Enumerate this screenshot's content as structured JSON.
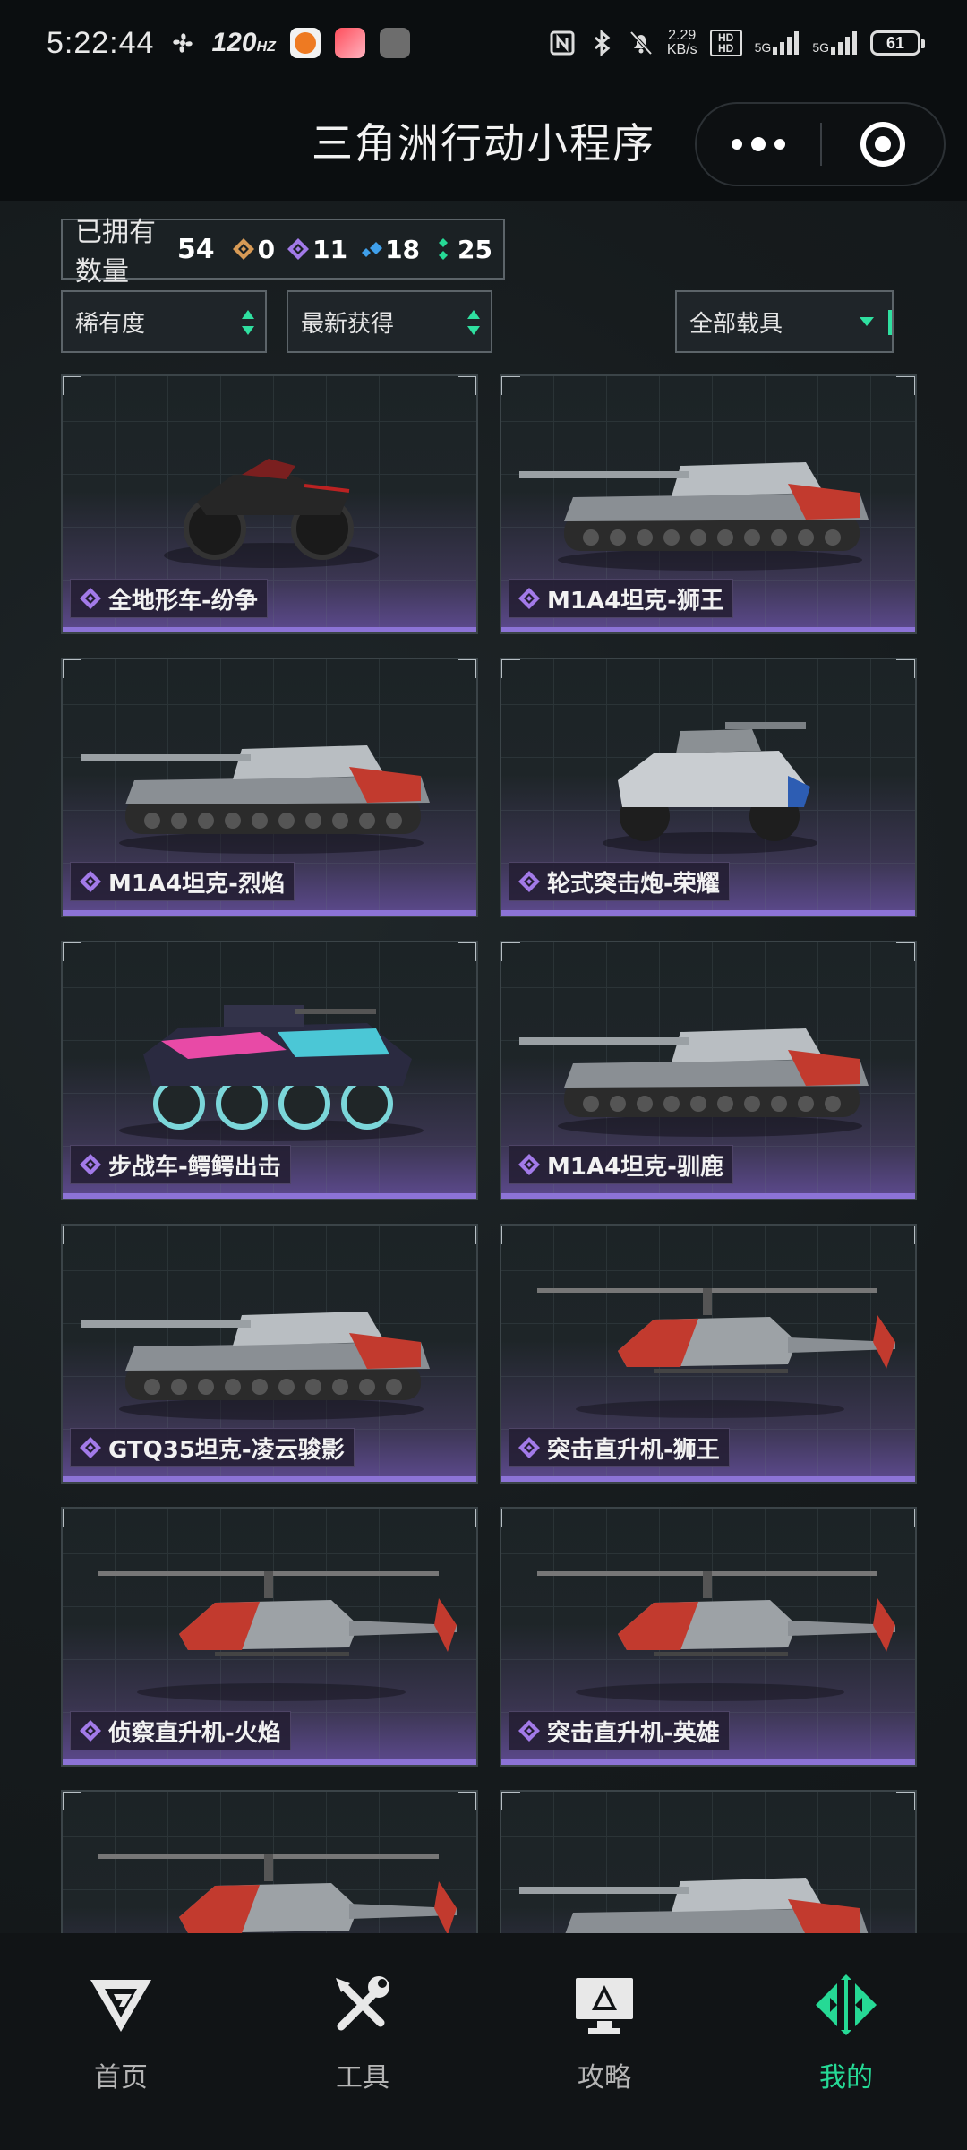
{
  "status_bar": {
    "time": "5:22:44",
    "refresh_rate": "120",
    "refresh_unit": "HZ",
    "net_speed_value": "2.29",
    "net_speed_unit": "KB/s",
    "hd_label": "HD HD",
    "sig1": "5G",
    "sig2": "5G",
    "battery": "61"
  },
  "header": {
    "title": "三角洲行动小程序"
  },
  "summary": {
    "owned_label": "已拥有数量",
    "owned_count": "54",
    "gold_count": "0",
    "purple_count": "11",
    "blue_count": "18",
    "green_count": "25",
    "colors": {
      "gold": "#d79a55",
      "purple": "#a27ae8",
      "blue": "#3f9fea",
      "green": "#26d995"
    }
  },
  "filters": {
    "rarity": "稀有度",
    "sort": "最新获得",
    "vehicle_type": "全部载具"
  },
  "vehicles": [
    {
      "name": "全地形车-纷争",
      "icon": "atv-icon"
    },
    {
      "name": "M1A4坦克-狮王",
      "icon": "tank-icon"
    },
    {
      "name": "M1A4坦克-烈焰",
      "icon": "tank-icon"
    },
    {
      "name": "轮式突击炮-荣耀",
      "icon": "armored-car-icon"
    },
    {
      "name": "步战车-鳄鳄出击",
      "icon": "ifv-icon"
    },
    {
      "name": "M1A4坦克-驯鹿",
      "icon": "tank-icon"
    },
    {
      "name": "GTQ35坦克-凌云骏影",
      "icon": "tank-icon"
    },
    {
      "name": "突击直升机-狮王",
      "icon": "helicopter-icon"
    },
    {
      "name": "侦察直升机-火焰",
      "icon": "helicopter-icon"
    },
    {
      "name": "突击直升机-英雄",
      "icon": "helicopter-icon"
    },
    {
      "name": "",
      "icon": "helicopter-icon"
    },
    {
      "name": "",
      "icon": "tank-icon"
    }
  ],
  "tabbar": {
    "home": "首页",
    "tools": "工具",
    "guide": "攻略",
    "mine": "我的",
    "active": "mine",
    "accent": "#26d995"
  }
}
